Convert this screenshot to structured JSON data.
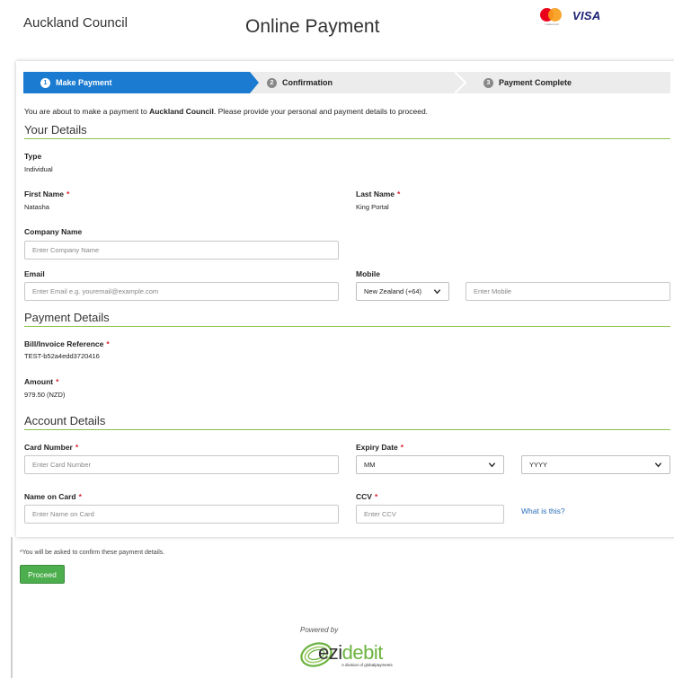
{
  "header": {
    "org_name": "Auckland Council",
    "page_title": "Online Payment",
    "card_brands": [
      "mastercard-logo",
      "visa-logo"
    ],
    "mastercard_caption": "mastercard",
    "visa_label": "VISA"
  },
  "steps": [
    {
      "num": "1",
      "label": "Make Payment",
      "active": true
    },
    {
      "num": "2",
      "label": "Confirmation",
      "active": false
    },
    {
      "num": "3",
      "label": "Payment Complete",
      "active": false
    }
  ],
  "intro": {
    "before": "You are about to make a payment to ",
    "org": "Auckland Council",
    "after": ". Please provide your personal and payment details to proceed."
  },
  "your_details": {
    "title": "Your Details",
    "type_label": "Type",
    "type_value": "Individual",
    "first_name_label": "First Name",
    "first_name_value": "Natasha",
    "last_name_label": "Last Name",
    "last_name_value": "King Portal",
    "company_label": "Company Name",
    "company_placeholder": "Enter Company Name",
    "email_label": "Email",
    "email_placeholder": "Enter Email e.g. youremail@example.com",
    "mobile_label": "Mobile",
    "mobile_country": "New Zealand (+64)",
    "mobile_placeholder": "Enter Mobile"
  },
  "payment_details": {
    "title": "Payment Details",
    "reference_label": "Bill/Invoice Reference",
    "reference_value": "TEST-b52a4edd3720416",
    "amount_label": "Amount",
    "amount_value": "979.50 (NZD)"
  },
  "account_details": {
    "title": "Account Details",
    "card_number_label": "Card Number",
    "card_number_placeholder": "Enter Card Number",
    "expiry_label": "Expiry Date",
    "expiry_month": "MM",
    "expiry_year": "YYYY",
    "name_label": "Name on Card",
    "name_placeholder": "Enter Name on Card",
    "ccv_label": "CCV",
    "ccv_placeholder": "Enter CCV",
    "what_is_this": "What is this?"
  },
  "footer": {
    "confirm_note": "*You will be asked to confirm these payment details.",
    "proceed_label": "Proceed",
    "powered_by": "Powered by",
    "ezi": "ezi",
    "debit": "debit",
    "tagline": "A division of globalpayments"
  },
  "colors": {
    "step_active": "#1a7bd1",
    "section_rule": "#8bc34a",
    "required": "#d9232d",
    "proceed": "#4cae4c",
    "link": "#2a6db8"
  }
}
